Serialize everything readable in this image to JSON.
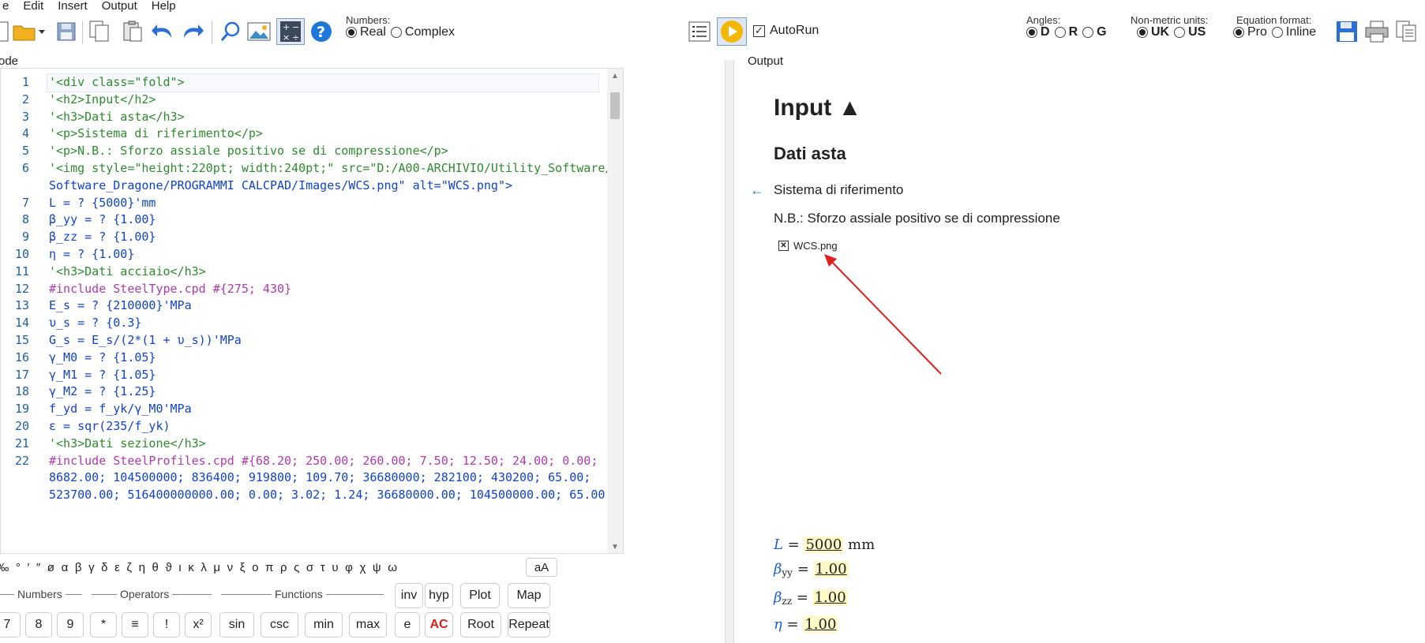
{
  "menu": [
    "e",
    "Edit",
    "Insert",
    "Output",
    "Help"
  ],
  "toolbar": {
    "numbers_label": "Numbers:",
    "numbers_options": [
      "Real",
      "Complex"
    ],
    "autorun_label": "AutoRun",
    "angles_label": "Angles:",
    "angles_options": [
      "D",
      "R",
      "G"
    ],
    "units_label": "Non-metric units:",
    "units_options": [
      "UK",
      "US"
    ],
    "eqformat_label": "Equation format:",
    "eqformat_options": [
      "Pro",
      "Inline"
    ]
  },
  "code_title": "ode",
  "output_title": "Output",
  "code_lines": [
    {
      "n": "1",
      "text": "'<div class=\"fold\">"
    },
    {
      "n": "2",
      "text": "'<h2>Input</h2>"
    },
    {
      "n": "3",
      "text": "'<h3>Dati asta</h3>"
    },
    {
      "n": "4",
      "text": "'<p>Sistema di riferimento</p>"
    },
    {
      "n": "5",
      "text": "'<p>N.B.: Sforzo assiale positivo se di compressione</p>"
    },
    {
      "n": "6",
      "text": "'<img style=\"height:220pt; width:240pt;\" src=\"D:/A00-ARCHIVIO/Utility_Software/"
    },
    {
      "n": "",
      "text": "Software_Dragone/PROGRAMMI CALCPAD/Images/WCS.png\" alt=\"WCS.png\">"
    },
    {
      "n": "7",
      "text": "L = ? {5000}'mm"
    },
    {
      "n": "8",
      "text": "β_yy = ? {1.00}"
    },
    {
      "n": "9",
      "text": "β_zz = ? {1.00}"
    },
    {
      "n": "10",
      "text": "η = ? {1.00}"
    },
    {
      "n": "11",
      "text": "'<h3>Dati acciaio</h3>"
    },
    {
      "n": "12",
      "text": "#include SteelType.cpd #{275; 430}"
    },
    {
      "n": "13",
      "text": "E_s = ? {210000}'MPa"
    },
    {
      "n": "14",
      "text": "υ_s = ? {0.3}"
    },
    {
      "n": "15",
      "text": "G_s = E_s/(2*(1 + υ_s))'MPa"
    },
    {
      "n": "16",
      "text": "γ_M0 = ? {1.05}"
    },
    {
      "n": "17",
      "text": "γ_M1 = ? {1.05}"
    },
    {
      "n": "18",
      "text": "γ_M2 = ? {1.25}"
    },
    {
      "n": "19",
      "text": "f_yd = f_yk/γ_M0'MPa"
    },
    {
      "n": "20",
      "text": "ε = sqr(235/f_yk)"
    },
    {
      "n": "21",
      "text": "'<h3>Dati sezione</h3>"
    },
    {
      "n": "22",
      "text": "#include SteelProfiles.cpd #{68.20; 250.00; 260.00; 7.50; 12.50; 24.00; 0.00;"
    },
    {
      "n": "",
      "text": "8682.00; 104500000; 836400; 919800; 109.70; 36680000; 282100; 430200; 65.00;"
    },
    {
      "n": "",
      "text": "523700.00; 516400000000.00; 0.00; 3.02; 1.24; 36680000.00; 104500000.00; 65.00;"
    }
  ],
  "symbols": [
    "‰",
    "°",
    "′",
    "″",
    "ø",
    "α",
    "β",
    "γ",
    "δ",
    "ε",
    "ζ",
    "η",
    "θ",
    "ϑ",
    "ι",
    "κ",
    "λ",
    "μ",
    "ν",
    "ξ",
    "ο",
    "π",
    "ρ",
    "ς",
    "σ",
    "τ",
    "υ",
    "φ",
    "χ",
    "ψ",
    "ω"
  ],
  "aa_label": "aA",
  "keyboard": {
    "group_numbers": "Numbers",
    "group_operators": "Operators",
    "group_functions": "Functions",
    "keys": {
      "inv": "inv",
      "hyp": "hyp",
      "plot": "Plot",
      "map": "Map",
      "seven": "7",
      "eight": "8",
      "nine": "9",
      "star": "*",
      "equiv": "≡",
      "excl": "!",
      "x2": "x²",
      "sin": "sin",
      "csc": "csc",
      "min": "min",
      "max": "max",
      "e": "e",
      "ac": "AC",
      "root": "Root",
      "repeat": "Repeat"
    }
  },
  "output": {
    "h2": "Input ▲",
    "h3": "Dati asta",
    "p1": "Sistema di riferimento",
    "p2": "N.B.: Sforzo assiale positivo se di compressione",
    "img_alt": "WCS.png",
    "eq_L_var": "L",
    "eq_L_val": "5000",
    "eq_L_unit": "mm",
    "eq_byy_var": "β",
    "eq_byy_sub": "yy",
    "eq_byy_val": "1.00",
    "eq_bzz_var": "β",
    "eq_bzz_sub": "zz",
    "eq_bzz_val": "1.00",
    "eq_eta_var": "η",
    "eq_eta_val": "1.00"
  }
}
